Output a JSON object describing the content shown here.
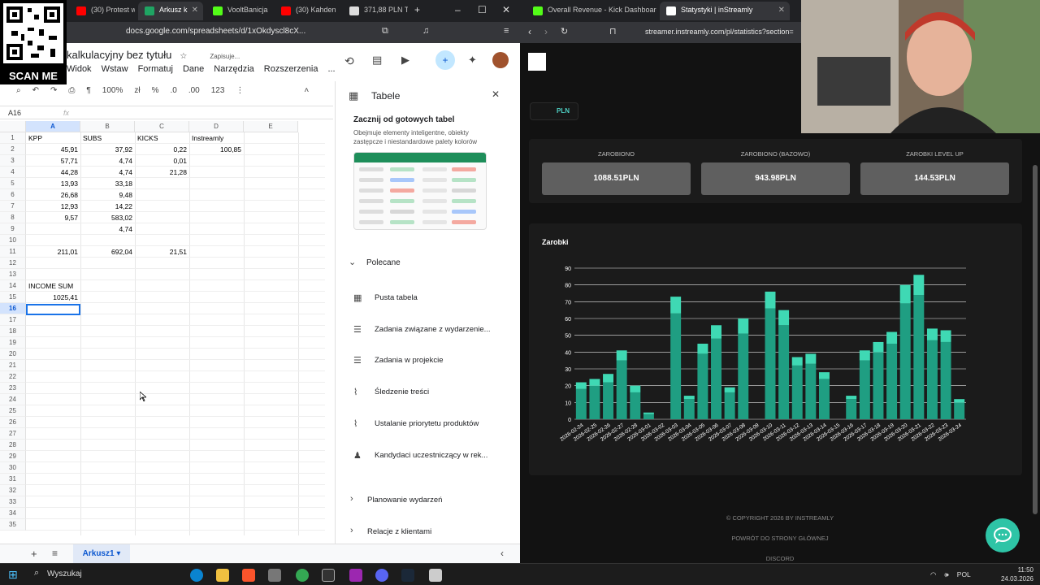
{
  "left_browser": {
    "tabs": [
      {
        "label": "(30) Protest w",
        "color": "#ff0000"
      },
      {
        "label": "Arkusz k",
        "color": "#1fa463"
      },
      {
        "label": "VooltBanicja",
        "color": "#53fc18"
      },
      {
        "label": "(30) Kahden",
        "color": "#ff0000"
      },
      {
        "label": "371,88 PLN T",
        "color": "#dddddd"
      }
    ],
    "url": "docs.google.com/spreadsheets/d/1xOkdyscl8cX..."
  },
  "overlay": {
    "scan_label": "SCAN ME"
  },
  "sheets": {
    "title": "kalkulacyjny bez tytułu",
    "saving": "Zapisuje...",
    "menus": [
      "Widok",
      "Wstaw",
      "Formatuj",
      "Dane",
      "Narzędzia",
      "Rozszerzenia",
      "..."
    ],
    "zoom": "100%",
    "toolbar_fmt": [
      "zł",
      "%",
      ".0",
      ".00",
      "123"
    ],
    "name_box": "A16",
    "fx": "fx",
    "column_headers": [
      "A",
      "B",
      "C",
      "D",
      "E"
    ],
    "row_count": 35,
    "cells": {
      "r1": {
        "A": "KPP",
        "B": "SUBS",
        "C": "KICKS",
        "D": "Instreamly"
      },
      "r2": {
        "A": "45,91",
        "B": "37,92",
        "C": "0,22",
        "D": "100,85"
      },
      "r3": {
        "A": "57,71",
        "B": "4,74",
        "C": "0,01"
      },
      "r4": {
        "A": "44,28",
        "B": "4,74",
        "C": "21,28"
      },
      "r5": {
        "A": "13,93",
        "B": "33,18"
      },
      "r6": {
        "A": "26,68",
        "B": "9,48"
      },
      "r7": {
        "A": "12,93",
        "B": "14,22"
      },
      "r8": {
        "A": "9,57",
        "B": "583,02"
      },
      "r9": {
        "B": "4,74"
      },
      "r11": {
        "A": "211,01",
        "B": "692,04",
        "C": "21,51"
      },
      "r14": {
        "A": "INCOME SUM"
      },
      "r15": {
        "A": "1025,41"
      }
    },
    "sheet_tab": "Arkusz1"
  },
  "panel": {
    "title": "Tabele",
    "heading": "Zacznij od gotowych tabel",
    "description": "Obejmuje elementy inteligentne, obiekty zastępcze i niestandardowe palety kolorów",
    "section_recommended": "Polecane",
    "items": [
      {
        "label": "Pusta tabela",
        "icon": "table-icon"
      },
      {
        "label": "Zadania związane z wydarzenie...",
        "icon": "checklist-icon"
      },
      {
        "label": "Zadania w projekcie",
        "icon": "checklist-icon"
      },
      {
        "label": "Śledzenie treści",
        "icon": "trend-icon"
      },
      {
        "label": "Ustalanie priorytetu produktów",
        "icon": "trend-icon"
      },
      {
        "label": "Kandydaci uczestniczący w rek...",
        "icon": "person-icon"
      }
    ],
    "collapsed": [
      "Planowanie wydarzeń",
      "Relacje z klientami"
    ]
  },
  "right_browser": {
    "tabs": [
      {
        "label": "Overall Revenue - Kick Dashboard",
        "color": "#53fc18"
      },
      {
        "label": "Statystyki | inStreamly",
        "color": "#ffffff"
      }
    ],
    "url": "streamer.instreamly.com/pl/statistics?section="
  },
  "instreamly": {
    "currency": "PLN",
    "stats": [
      {
        "label": "ZAROBIONO",
        "value": "1088.51PLN"
      },
      {
        "label": "ZAROBIONO (BAZOWO)",
        "value": "943.98PLN"
      },
      {
        "label": "ZAROBKI LEVEL UP",
        "value": "144.53PLN"
      }
    ],
    "footer": {
      "copyright": "© COPYRIGHT 2026 BY INSTREAMLY",
      "back": "POWRÓT DO STRONY GŁÓWNEJ",
      "discord": "DISCORD"
    }
  },
  "chart_data": {
    "type": "bar",
    "title": "Zarobki",
    "ylim": [
      0,
      90
    ],
    "yticks": [
      0,
      10,
      20,
      30,
      40,
      50,
      60,
      70,
      80,
      90
    ],
    "grid": true,
    "stacked": true,
    "colors": {
      "base": "#1f9e82",
      "top": "#3fd9b4"
    },
    "categories": [
      "2026-02-24",
      "2026-02-25",
      "2026-02-26",
      "2026-02-27",
      "2026-02-28",
      "2026-03-01",
      "2026-03-02",
      "2026-03-03",
      "2026-03-04",
      "2026-03-05",
      "2026-03-06",
      "2026-03-07",
      "2026-03-08",
      "2026-03-09",
      "2026-03-10",
      "2026-03-11",
      "2026-03-12",
      "2026-03-13",
      "2026-03-14",
      "2026-03-15",
      "2026-03-16",
      "2026-03-17",
      "2026-03-18",
      "2026-03-19",
      "2026-03-20",
      "2026-03-21",
      "2026-03-22",
      "2026-03-23",
      "2026-03-24"
    ],
    "xtick_labels": [
      "2026-02-24",
      "2026-02-25",
      "2026-02-26",
      "2026-02-27",
      "2026-02-28",
      "2026-03-01",
      "2026-03-02",
      "2026-03-03",
      "2026-03-04",
      "2026-03-05",
      "2026-03-06",
      "2026-03-07",
      "2026-03-08",
      "2026-03-09",
      "2026-03-10",
      "2026-03-11",
      "2026-03-12",
      "2026-03-13",
      "2026-03-14",
      "2026-03-15",
      "2026-03-16",
      "2026-03-17",
      "2026-03-18",
      "2026-03-19",
      "2026-03-20",
      "2026-03-21",
      "2026-03-22",
      "2026-03-23",
      "2026-03-24"
    ],
    "series": [
      {
        "values": [
          18,
          20,
          22,
          35,
          16,
          3,
          0,
          63,
          12,
          39,
          48,
          16,
          51,
          0,
          66,
          56,
          32,
          33,
          24,
          0,
          12,
          35,
          40,
          45,
          69,
          74,
          47,
          46,
          10
        ]
      },
      {
        "values": [
          4,
          4,
          5,
          6,
          4,
          1,
          0,
          10,
          2,
          6,
          8,
          3,
          9,
          0,
          10,
          9,
          5,
          6,
          4,
          0,
          2,
          6,
          6,
          7,
          11,
          12,
          7,
          7,
          2
        ]
      }
    ]
  },
  "taskbar": {
    "search": "Wyszukaj",
    "lang": "POL",
    "time": "11:50",
    "date": "24.03.2026"
  }
}
